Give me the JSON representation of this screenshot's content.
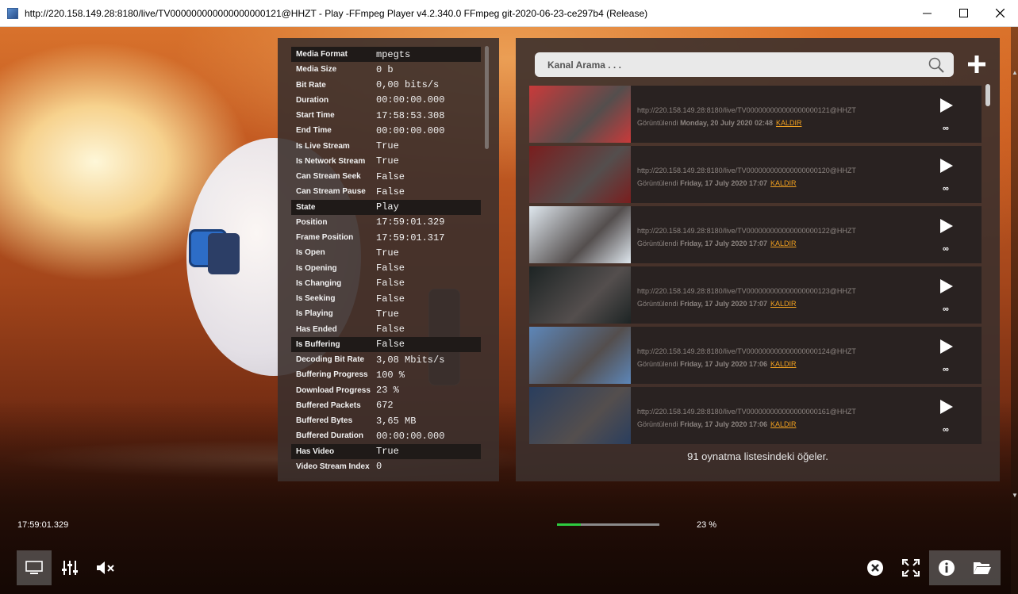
{
  "window": {
    "title": "http://220.158.149.28:8180/live/TV000000000000000000121@HHZT - Play -FFmpeg Player v4.2.340.0 FFmpeg git-2020-06-23-ce297b4 (Release)",
    "minimize_icon": "minimize-icon",
    "maximize_icon": "maximize-icon",
    "close_icon": "close-icon"
  },
  "info": {
    "rows": [
      {
        "label": "Media Format",
        "value": "mpegts",
        "header": true
      },
      {
        "label": "Media Size",
        "value": "0 b",
        "header": false
      },
      {
        "label": "Bit Rate",
        "value": "0,00 bits/s",
        "header": false
      },
      {
        "label": "Duration",
        "value": "00:00:00.000",
        "header": false
      },
      {
        "label": "Start Time",
        "value": "17:58:53.308",
        "header": false
      },
      {
        "label": "End Time",
        "value": "00:00:00.000",
        "header": false
      },
      {
        "label": "Is Live Stream",
        "value": "True",
        "header": false
      },
      {
        "label": "Is Network Stream",
        "value": "True",
        "header": false
      },
      {
        "label": "Can Stream Seek",
        "value": "False",
        "header": false
      },
      {
        "label": "Can Stream Pause",
        "value": "False",
        "header": false
      },
      {
        "label": "State",
        "value": "Play",
        "header": true
      },
      {
        "label": "Position",
        "value": "17:59:01.329",
        "header": false
      },
      {
        "label": "Frame Position",
        "value": "17:59:01.317",
        "header": false
      },
      {
        "label": "Is Open",
        "value": "True",
        "header": false
      },
      {
        "label": "Is Opening",
        "value": "False",
        "header": false
      },
      {
        "label": "Is Changing",
        "value": "False",
        "header": false
      },
      {
        "label": "Is Seeking",
        "value": "False",
        "header": false
      },
      {
        "label": "Is Playing",
        "value": "True",
        "header": false
      },
      {
        "label": "Has Ended",
        "value": "False",
        "header": false
      },
      {
        "label": "Is Buffering",
        "value": "False",
        "header": true
      },
      {
        "label": "Decoding Bit Rate",
        "value": "3,08 Mbits/s",
        "header": false
      },
      {
        "label": "Buffering Progress",
        "value": "100 %",
        "header": false
      },
      {
        "label": "Download Progress",
        "value": "23 %",
        "header": false
      },
      {
        "label": "Buffered Packets",
        "value": "672",
        "header": false
      },
      {
        "label": "Buffered Bytes",
        "value": "3,65 MB",
        "header": false
      },
      {
        "label": "Buffered Duration",
        "value": "00:00:00.000",
        "header": false
      },
      {
        "label": "Has Video",
        "value": "True",
        "header": true
      },
      {
        "label": "Video Stream Index",
        "value": "0",
        "header": false
      }
    ]
  },
  "playlist": {
    "search_placeholder": "Kanal Arama . . .",
    "search_icon": "search-icon",
    "add_icon": "plus-icon",
    "viewed_prefix": "Görüntülendi",
    "remove_label": "KALDIR",
    "infinity": "∞",
    "items": [
      {
        "url": "http://220.158.149.28:8180/live/TV000000000000000000121@HHZT",
        "date": "Monday, 20 July 2020 02:48",
        "thumb": "#c93a3a"
      },
      {
        "url": "http://220.158.149.28:8180/live/TV000000000000000000120@HHZT",
        "date": "Friday, 17 July 2020 17:07",
        "thumb": "#7a1e1e"
      },
      {
        "url": "http://220.158.149.28:8180/live/TV000000000000000000122@HHZT",
        "date": "Friday, 17 July 2020 17:07",
        "thumb": "#dfe7ee"
      },
      {
        "url": "http://220.158.149.28:8180/live/TV000000000000000000123@HHZT",
        "date": "Friday, 17 July 2020 17:07",
        "thumb": "#1d2424"
      },
      {
        "url": "http://220.158.149.28:8180/live/TV000000000000000000124@HHZT",
        "date": "Friday, 17 July 2020 17:06",
        "thumb": "#5d86b8"
      },
      {
        "url": "http://220.158.149.28:8180/live/TV000000000000000000161@HHZT",
        "date": "Friday, 17 July 2020 17:06",
        "thumb": "#2a3e5e"
      }
    ],
    "footer": "91 oynatma listesindeki öğeler."
  },
  "status": {
    "time": "17:59:01.329",
    "download_percent_label": "23 %",
    "download_fraction": 0.23
  },
  "controls": {
    "left": [
      "display-icon",
      "equalizer-icon",
      "mute-icon"
    ],
    "right": [
      "stop-icon",
      "fullscreen-icon",
      "info-icon",
      "folder-icon"
    ]
  },
  "colors": {
    "accent_green": "#2ecc40",
    "remove_link": "#f0a020",
    "panel_bg": "#3c302c"
  }
}
